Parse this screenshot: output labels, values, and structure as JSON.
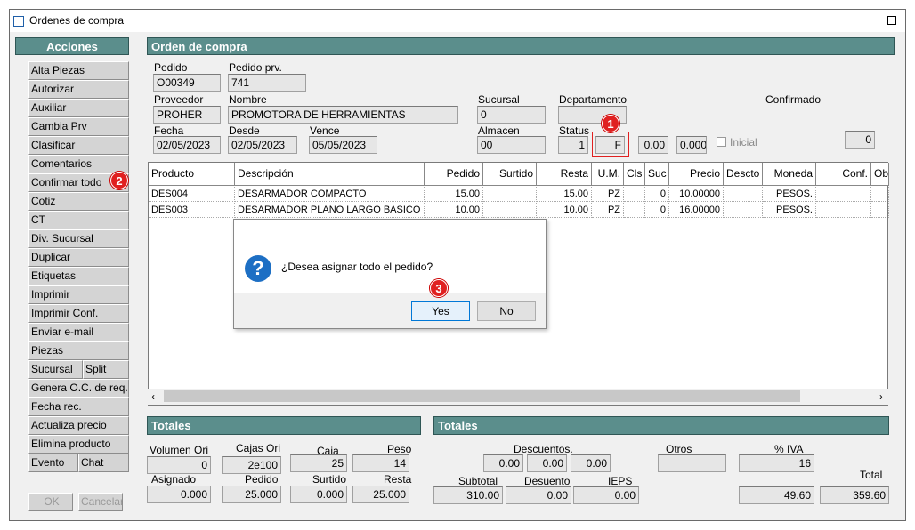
{
  "window": {
    "title": "Ordenes de compra"
  },
  "acciones": {
    "header": "Acciones",
    "items": [
      "Alta Piezas",
      "Autorizar",
      "Auxiliar",
      "Cambia Prv",
      "Clasificar",
      "Comentarios",
      "Confirmar todo",
      "Cotiz",
      "CT",
      "Div. Sucursal",
      "Duplicar",
      "Etiquetas",
      "Imprimir",
      "Imprimir Conf.",
      "Enviar e-mail",
      "Piezas"
    ],
    "sucursal": "Sucursal",
    "split": "Split",
    "genera": "Genera O.C. de req.",
    "fecha_rec": "Fecha rec.",
    "actualiza": "Actualiza precio",
    "elimina": "Elimina producto",
    "evento": "Evento",
    "chat": "Chat",
    "ok": "OK",
    "cancelar": "Cancelar"
  },
  "orden": {
    "header": "Orden de compra",
    "pedido_label": "Pedido",
    "pedido": "O00349",
    "pedido_prv_label": "Pedido prv.",
    "pedido_prv": "741",
    "proveedor_label": "Proveedor",
    "proveedor": "PROHER",
    "nombre_label": "Nombre",
    "nombre": "PROMOTORA DE HERRAMIENTAS",
    "sucursal_label": "Sucursal",
    "sucursal": "0",
    "departamento_label": "Departamento",
    "departamento": "",
    "confirmado_label": "Confirmado",
    "fecha_label": "Fecha",
    "fecha": "02/05/2023",
    "desde_label": "Desde",
    "desde": "02/05/2023",
    "vence_label": "Vence",
    "vence": "05/05/2023",
    "almacen_label": "Almacen",
    "almacen": "00",
    "status_label": "Status",
    "status_num": "1",
    "status": "F",
    "val1": "0.00",
    "val2": "0.000",
    "inicial_label": "Inicial",
    "right_val": "0"
  },
  "grid": {
    "columns": [
      "Producto",
      "Descripción",
      "Pedido",
      "Surtido",
      "Resta",
      "U.M.",
      "Cls",
      "Suc",
      "Precio",
      "Descto",
      "Moneda",
      "Conf.",
      "Obs."
    ],
    "rows": [
      [
        "DES004",
        "DESARMADOR COMPACTO",
        "15.00",
        "",
        "15.00",
        "PZ",
        "",
        "0",
        "10.00000",
        "",
        "PESOS.",
        "",
        ""
      ],
      [
        "DES003",
        "DESARMADOR PLANO LARGO BASICO",
        "10.00",
        "",
        "10.00",
        "PZ",
        "",
        "0",
        "16.00000",
        "",
        "PESOS.",
        "",
        ""
      ]
    ]
  },
  "dialog": {
    "message": "¿Desea asignar todo el pedido?",
    "yes": "Yes",
    "no": "No",
    "icon": "?"
  },
  "badges": {
    "b1": "1",
    "b2": "2",
    "b3": "3"
  },
  "totales_left": {
    "header": "Totales",
    "volumen_ori_label": "Volumen Ori",
    "volumen_ori": "0",
    "cajas_ori_label": "Cajas Ori",
    "cajas_ori": "2e100",
    "caja_label": "Caja",
    "caja": "25",
    "peso_label": "Peso",
    "peso": "14",
    "asignado_label": "Asignado",
    "asignado": "0.000",
    "pedido_label": "Pedido",
    "pedido": "25.000",
    "surtido_label": "Surtido",
    "surtido": "0.000",
    "resta_label": "Resta",
    "resta": "25.000"
  },
  "totales_right": {
    "header": "Totales",
    "descuentos_label": "Descuentos.",
    "d1": "0.00",
    "d2": "0.00",
    "d3": "0.00",
    "otros_label": "Otros",
    "otros": "",
    "iva_label": "% IVA",
    "iva": "16",
    "total_label": "Total",
    "subtotal_label": "Subtotal",
    "subtotal": "310.00",
    "desuento_label": "Desuento",
    "desuento": "0.00",
    "ieps_label": "IEPS",
    "ieps": "0.00",
    "iva_amt": "49.60",
    "total": "359.60"
  },
  "colors": {
    "header_bg": "#5b8e8c",
    "badge": "#e02020",
    "dialog_default": "#0078d7"
  }
}
